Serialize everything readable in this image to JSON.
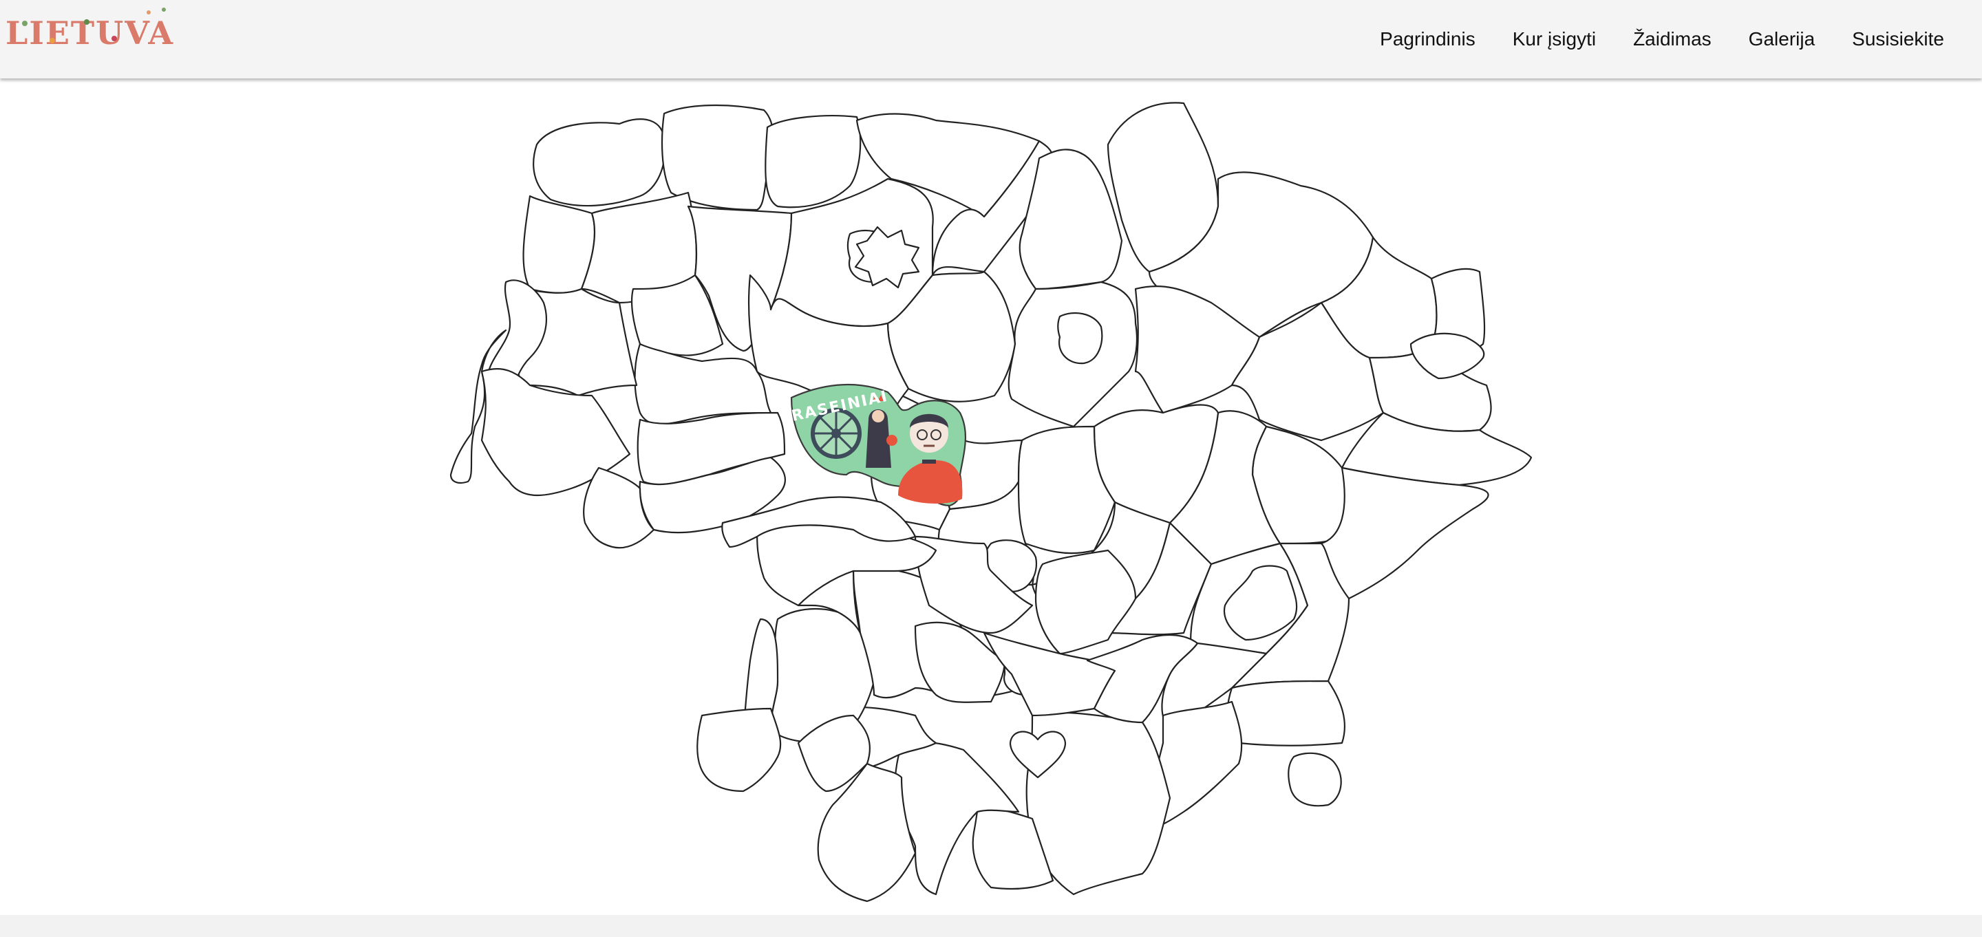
{
  "header": {
    "logo_text": "LIETUVA",
    "nav": [
      {
        "label": "Pagrindinis"
      },
      {
        "label": "Kur įsigyti"
      },
      {
        "label": "Žaidimas"
      },
      {
        "label": "Galerija"
      },
      {
        "label": "Susisiekite"
      }
    ]
  },
  "map": {
    "highlighted_region": {
      "label": "RASEINIAI",
      "color": "#8fd4a6"
    },
    "region_count": 60
  },
  "colors": {
    "header_bg": "#f4f4f4",
    "region_stroke": "#222222",
    "highlight_green": "#8fd4a6",
    "accent_red": "#e8553e"
  }
}
